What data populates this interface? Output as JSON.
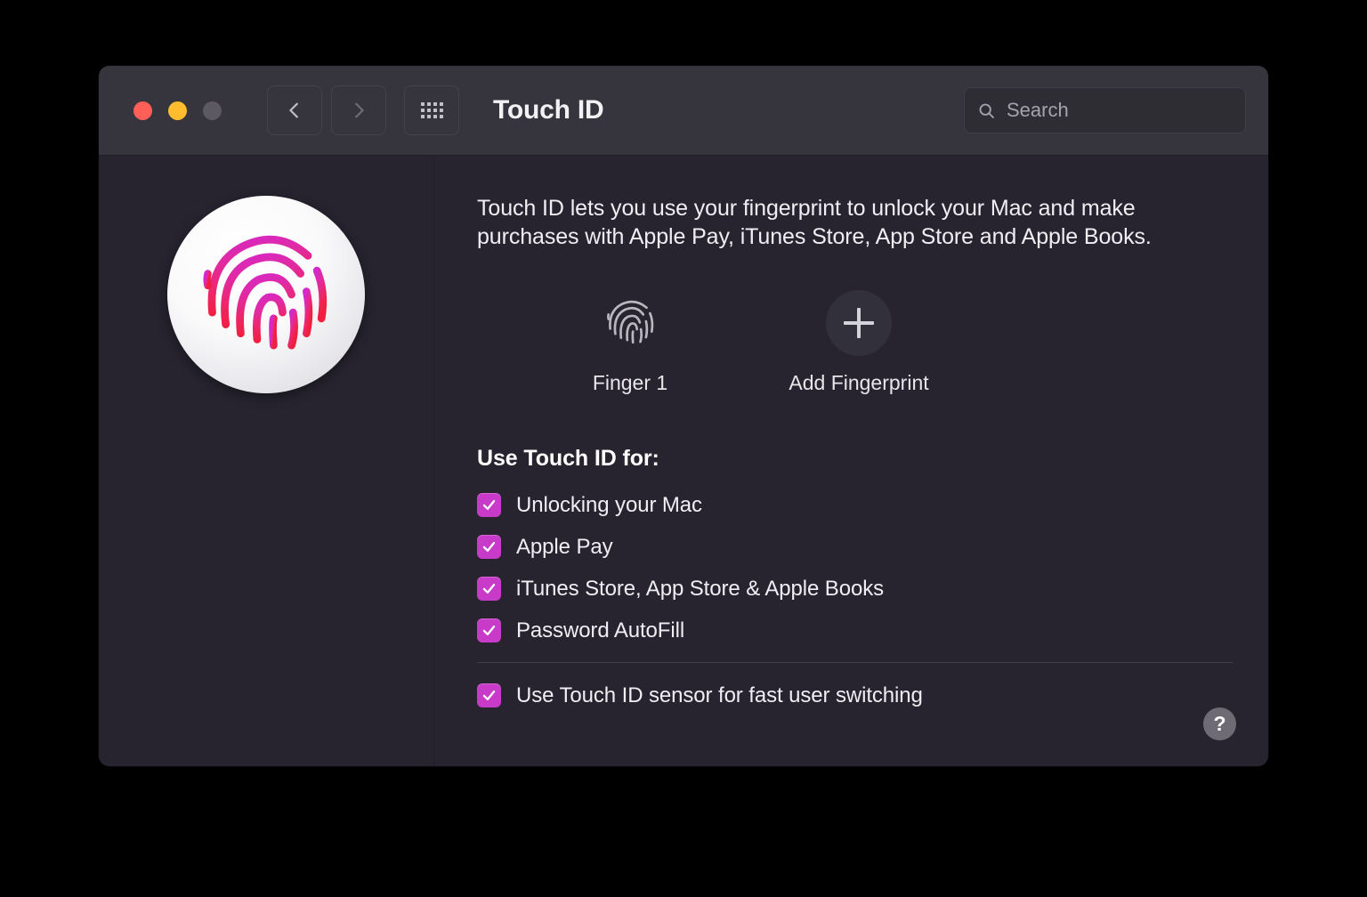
{
  "window": {
    "title": "Touch ID",
    "traffic_lights": {
      "close_color": "#FF5F57",
      "minimize_color": "#FEBC2E",
      "zoom_color": "#5C5A60"
    }
  },
  "toolbar": {
    "back_icon": "chevron-left-icon",
    "forward_icon": "chevron-right-icon",
    "grid_icon": "show-all-grid-icon",
    "search": {
      "placeholder": "Search",
      "value": "",
      "icon": "search-icon"
    }
  },
  "sidebar": {
    "icon_name": "touch-id-app-icon"
  },
  "main": {
    "description": "Touch ID lets you use your fingerprint to unlock your Mac and make purchases with Apple Pay, iTunes Store, App Store and Apple Books.",
    "fingerprints": [
      {
        "label": "Finger 1",
        "icon": "fingerprint-icon"
      },
      {
        "label": "Add Fingerprint",
        "icon": "plus-icon"
      }
    ],
    "section_title": "Use Touch ID for:",
    "options": [
      {
        "label": "Unlocking your Mac",
        "checked": true
      },
      {
        "label": "Apple Pay",
        "checked": true
      },
      {
        "label": "iTunes Store, App Store & Apple Books",
        "checked": true
      },
      {
        "label": "Password AutoFill",
        "checked": true
      }
    ],
    "fast_user_switching": {
      "label": "Use Touch ID sensor for fast user switching",
      "checked": true
    },
    "help_label": "?"
  },
  "colors": {
    "accent": "#C83BC8",
    "window_background": "#272430",
    "toolbar_background": "#36343C",
    "text_primary": "#EFEEF2"
  }
}
